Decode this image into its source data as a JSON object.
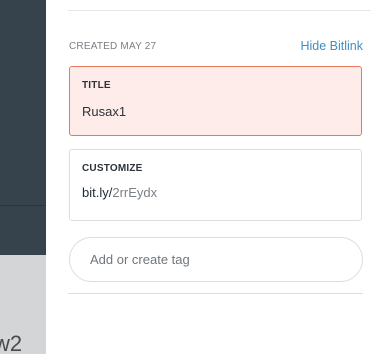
{
  "background": {
    "partial_text": "w2"
  },
  "panel": {
    "created_label": "CREATED MAY 27",
    "hide_link": "Hide Bitlink",
    "title_field": {
      "label": "TITLE",
      "value": "Rusax1"
    },
    "customize_field": {
      "label": "CUSTOMIZE",
      "domain": "bit.ly/",
      "slug": "2rrEydx"
    },
    "tag_input": {
      "placeholder": "Add or create tag"
    }
  },
  "colors": {
    "sidebar_dark": "#36434d",
    "link_blue": "#3f8fc3",
    "error_border": "#e47b5c",
    "error_fill": "#fdecea"
  }
}
